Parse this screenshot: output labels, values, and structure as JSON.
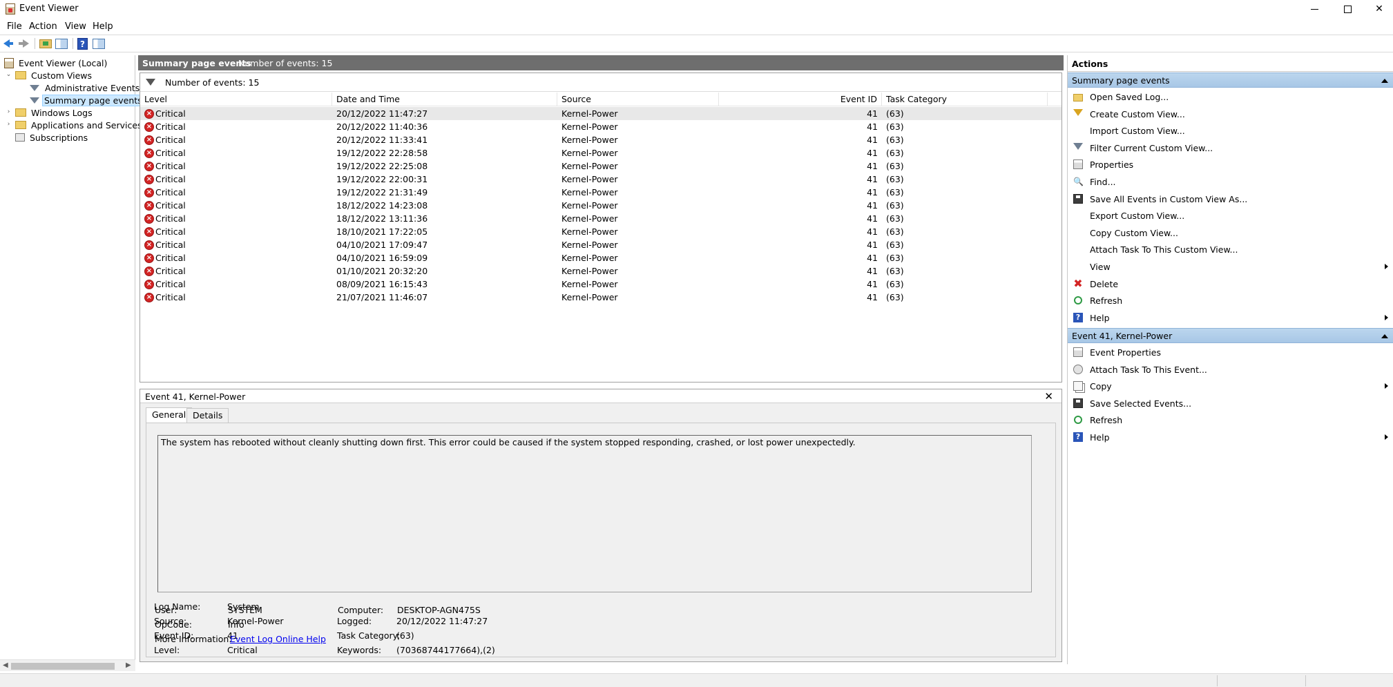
{
  "window": {
    "title": "Event Viewer",
    "controls": {
      "minimize": "minimize",
      "maximize": "maximize",
      "close": "✕"
    }
  },
  "menu": [
    "File",
    "Action",
    "View",
    "Help"
  ],
  "toolbar": [
    "back-arrow-icon",
    "forward-arrow-icon",
    "folder-icon",
    "show-hide-pane-icon",
    "help-icon",
    "show-hide-action-pane-icon"
  ],
  "tree": {
    "root": "Event Viewer (Local)",
    "custom_views": "Custom Views",
    "administrative_events": "Administrative Events",
    "summary_page_events": "Summary page events",
    "windows_logs": "Windows Logs",
    "app_services": "Applications and Services Lo",
    "subscriptions": "Subscriptions"
  },
  "center": {
    "header_title": "Summary page events",
    "header_count": "Number of events: 15",
    "filter_text": "Number of events: 15",
    "columns": [
      "Level",
      "Date and Time",
      "Source",
      "Event ID",
      "Task Category"
    ],
    "rows": [
      {
        "level": "Critical",
        "datetime": "20/12/2022 11:47:27",
        "source": "Kernel-Power",
        "event_id": "41",
        "task": "(63)"
      },
      {
        "level": "Critical",
        "datetime": "20/12/2022 11:40:36",
        "source": "Kernel-Power",
        "event_id": "41",
        "task": "(63)"
      },
      {
        "level": "Critical",
        "datetime": "20/12/2022 11:33:41",
        "source": "Kernel-Power",
        "event_id": "41",
        "task": "(63)"
      },
      {
        "level": "Critical",
        "datetime": "19/12/2022 22:28:58",
        "source": "Kernel-Power",
        "event_id": "41",
        "task": "(63)"
      },
      {
        "level": "Critical",
        "datetime": "19/12/2022 22:25:08",
        "source": "Kernel-Power",
        "event_id": "41",
        "task": "(63)"
      },
      {
        "level": "Critical",
        "datetime": "19/12/2022 22:00:31",
        "source": "Kernel-Power",
        "event_id": "41",
        "task": "(63)"
      },
      {
        "level": "Critical",
        "datetime": "19/12/2022 21:31:49",
        "source": "Kernel-Power",
        "event_id": "41",
        "task": "(63)"
      },
      {
        "level": "Critical",
        "datetime": "18/12/2022 14:23:08",
        "source": "Kernel-Power",
        "event_id": "41",
        "task": "(63)"
      },
      {
        "level": "Critical",
        "datetime": "18/12/2022 13:11:36",
        "source": "Kernel-Power",
        "event_id": "41",
        "task": "(63)"
      },
      {
        "level": "Critical",
        "datetime": "18/10/2021 17:22:05",
        "source": "Kernel-Power",
        "event_id": "41",
        "task": "(63)"
      },
      {
        "level": "Critical",
        "datetime": "04/10/2021 17:09:47",
        "source": "Kernel-Power",
        "event_id": "41",
        "task": "(63)"
      },
      {
        "level": "Critical",
        "datetime": "04/10/2021 16:59:09",
        "source": "Kernel-Power",
        "event_id": "41",
        "task": "(63)"
      },
      {
        "level": "Critical",
        "datetime": "01/10/2021 20:32:20",
        "source": "Kernel-Power",
        "event_id": "41",
        "task": "(63)"
      },
      {
        "level": "Critical",
        "datetime": "08/09/2021 16:15:43",
        "source": "Kernel-Power",
        "event_id": "41",
        "task": "(63)"
      },
      {
        "level": "Critical",
        "datetime": "21/07/2021 11:46:07",
        "source": "Kernel-Power",
        "event_id": "41",
        "task": "(63)"
      }
    ]
  },
  "details": {
    "title": "Event 41, Kernel-Power",
    "close": "✕",
    "tabs": [
      "General",
      "Details"
    ],
    "message": "The system has rebooted without cleanly shutting down first. This error could be caused if the system stopped responding, crashed, or lost power unexpectedly.",
    "labels": {
      "log_name": "Log Name:",
      "source": "Source:",
      "event_id": "Event ID:",
      "level": "Level:",
      "user": "User:",
      "opcode": "OpCode:",
      "more_info": "More Information:",
      "logged": "Logged:",
      "task_category": "Task Category:",
      "keywords": "Keywords:",
      "computer": "Computer:"
    },
    "values": {
      "log_name": "System",
      "source": "Kernel-Power",
      "event_id": "41",
      "level": "Critical",
      "user": "SYSTEM",
      "opcode": "Info",
      "more_info": "Event Log Online Help",
      "logged": "20/12/2022 11:47:27",
      "task_category": "(63)",
      "keywords": "(70368744177664),(2)",
      "computer": "DESKTOP-AGN475S"
    }
  },
  "actions": {
    "title": "Actions",
    "section1": "Summary page events",
    "items1": [
      {
        "label": "Open Saved Log...",
        "icon": "open-folder-icon"
      },
      {
        "label": "Create Custom View...",
        "icon": "create-filter-icon"
      },
      {
        "label": "Import Custom View...",
        "icon": ""
      },
      {
        "label": "Filter Current Custom View...",
        "icon": "filter-icon"
      },
      {
        "label": "Properties",
        "icon": "properties-icon"
      },
      {
        "label": "Find...",
        "icon": "binoculars-icon",
        "glyph": "🔍"
      },
      {
        "label": "Save All Events in Custom View As...",
        "icon": "save-icon"
      },
      {
        "label": "Export Custom View...",
        "icon": ""
      },
      {
        "label": "Copy Custom View...",
        "icon": ""
      },
      {
        "label": "Attach Task To This Custom View...",
        "icon": ""
      },
      {
        "label": "View",
        "icon": "",
        "submenu": true
      },
      {
        "label": "Delete",
        "icon": "delete-icon",
        "glyph": "✖"
      },
      {
        "label": "Refresh",
        "icon": "refresh-icon"
      },
      {
        "label": "Help",
        "icon": "help-icon",
        "glyph": "?",
        "submenu": true
      }
    ],
    "section2": "Event 41, Kernel-Power",
    "items2": [
      {
        "label": "Event Properties",
        "icon": "event-properties-icon"
      },
      {
        "label": "Attach Task To This Event...",
        "icon": "attach-task-icon"
      },
      {
        "label": "Copy",
        "icon": "copy-icon",
        "submenu": true
      },
      {
        "label": "Save Selected Events...",
        "icon": "save-icon"
      },
      {
        "label": "Refresh",
        "icon": "refresh-icon"
      },
      {
        "label": "Help",
        "icon": "help-icon",
        "glyph": "?",
        "submenu": true
      }
    ]
  },
  "colors": {
    "header_bg": "#6e6e6e",
    "section_bg": "#a8c7e6",
    "critical": "#d32424",
    "link": "#0000ee"
  }
}
